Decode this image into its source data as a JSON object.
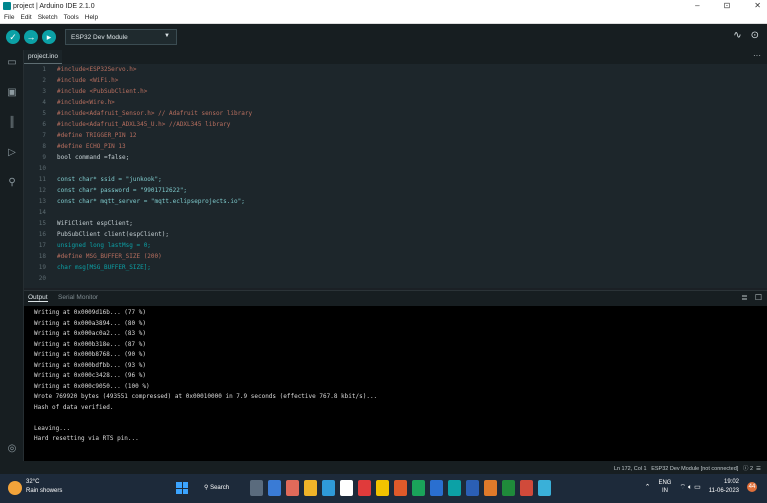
{
  "window": {
    "title": "project | Arduino IDE 2.1.0",
    "controls": [
      "–",
      "⊡",
      "✕"
    ]
  },
  "menu": [
    "File",
    "Edit",
    "Sketch",
    "Tools",
    "Help"
  ],
  "toolbar": {
    "board": "ESP32 Dev Module"
  },
  "tabs": {
    "file": "project.ino",
    "more": "···"
  },
  "code_lines": [
    {
      "n": "1",
      "text": "#include<ESP32Servo.h>"
    },
    {
      "n": "2",
      "text": "#include <WiFi.h>"
    },
    {
      "n": "3",
      "text": "#include <PubSubClient.h>"
    },
    {
      "n": "4",
      "text": "#include<Wire.h>"
    },
    {
      "n": "5",
      "text": "#include<Adafruit_Sensor.h> // Adafruit sensor library"
    },
    {
      "n": "6",
      "text": "#include<Adafruit_ADXL345_U.h> //ADXL345 library"
    },
    {
      "n": "7",
      "text": "#define TRIGGER_PIN 12"
    },
    {
      "n": "8",
      "text": "#define ECHO_PIN 13"
    },
    {
      "n": "9",
      "text": "bool command =false;"
    },
    {
      "n": "10",
      "text": ""
    },
    {
      "n": "11",
      "text": "const char* ssid = \"junkook\";"
    },
    {
      "n": "12",
      "text": "const char* password = \"9901712622\";"
    },
    {
      "n": "13",
      "text": "const char* mqtt_server = \"mqtt.eclipseprojects.io\";"
    },
    {
      "n": "14",
      "text": ""
    },
    {
      "n": "15",
      "text": "WiFiClient espClient;"
    },
    {
      "n": "16",
      "text": "PubSubClient client(espClient);"
    },
    {
      "n": "17",
      "text": "unsigned long lastMsg = 0;"
    },
    {
      "n": "18",
      "text": "#define MSG_BUFFER_SIZE (200)"
    },
    {
      "n": "19",
      "text": "char msg[MSG_BUFFER_SIZE];"
    },
    {
      "n": "20",
      "text": ""
    }
  ],
  "output_panel": {
    "tab_output": "Output",
    "tab_serial": "Serial Monitor",
    "lines": [
      "Writing at 0x0009d16b... (77 %)",
      "Writing at 0x000a3894... (80 %)",
      "Writing at 0x000ac0a2... (83 %)",
      "Writing at 0x000b318e... (87 %)",
      "Writing at 0x000b8768... (90 %)",
      "Writing at 0x000bdfbb... (93 %)",
      "Writing at 0x000c3428... (96 %)",
      "Writing at 0x000c9050... (100 %)",
      "Wrote 769920 bytes (493551 compressed) at 0x00010000 in 7.9 seconds (effective 767.8 kbit/s)...",
      "Hash of data verified.",
      "",
      "Leaving...",
      "Hard resetting via RTS pin..."
    ]
  },
  "status_bar": {
    "text": "Ln 172, Col 1   ESP32 Dev Module [not connected]   ⓘ 2  ☰"
  },
  "taskbar": {
    "weather_temp": "32°C",
    "weather_desc": "Rain showers",
    "search": "Search",
    "lang_top": "ENG",
    "lang_bottom": "IN",
    "time": "19:02",
    "date": "11-06-2023",
    "notifications": "44"
  }
}
